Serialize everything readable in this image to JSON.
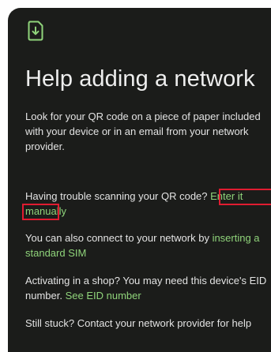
{
  "header": {
    "icon": "sim-download-icon",
    "title": "Help adding a network"
  },
  "content": {
    "intro": "Look for your QR code on a piece of paper included with your device or in an email from your network provider.",
    "trouble_text": "Having trouble scanning your QR code? ",
    "enter_link_part1": "Enter it",
    "enter_link_part2": "manually",
    "sim_text": "You can also connect to your network by ",
    "sim_link": "inserting a standard SIM",
    "shop_text": "Activating in a shop? You may need this device's EID number. ",
    "eid_link": "See EID number",
    "stuck_text": "Still stuck? Contact your network provider for help"
  },
  "colors": {
    "panel_bg": "#1b1c1a",
    "text": "#e3e3e3",
    "link": "#8fd37a",
    "highlight": "#e01c31"
  }
}
